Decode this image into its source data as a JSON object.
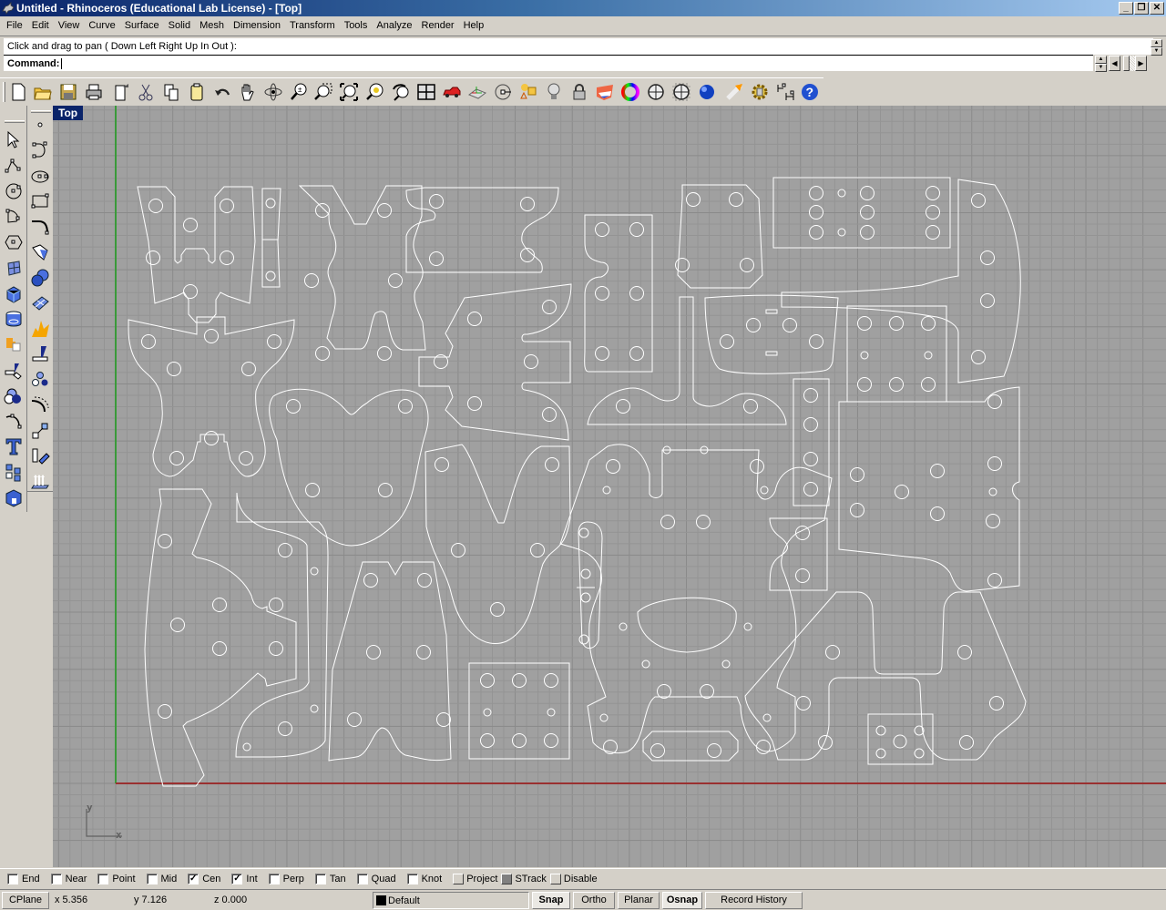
{
  "window": {
    "title": "Untitled - Rhinoceros (Educational Lab License) - [Top]",
    "controls": [
      "minimize",
      "restore",
      "close"
    ]
  },
  "menu": [
    "File",
    "Edit",
    "View",
    "Curve",
    "Surface",
    "Solid",
    "Mesh",
    "Dimension",
    "Transform",
    "Tools",
    "Analyze",
    "Render",
    "Help"
  ],
  "command": {
    "history": "Click and drag to pan ( Down  Left  Right  Up  In  Out ):",
    "prompt_label": "Command:",
    "value": ""
  },
  "toolbar": [
    {
      "name": "new-icon",
      "tip": "New"
    },
    {
      "name": "open-icon",
      "tip": "Open"
    },
    {
      "name": "save-icon",
      "tip": "Save"
    },
    {
      "name": "print-icon",
      "tip": "Print"
    },
    {
      "name": "import-icon",
      "tip": "Import"
    },
    {
      "name": "cut-icon",
      "tip": "Cut"
    },
    {
      "name": "copy-icon",
      "tip": "Copy"
    },
    {
      "name": "paste-icon",
      "tip": "Paste"
    },
    {
      "name": "undo-icon",
      "tip": "Undo"
    },
    {
      "name": "pan-icon",
      "tip": "Pan"
    },
    {
      "name": "rotate-view-icon",
      "tip": "Rotate View"
    },
    {
      "name": "zoom-dynamic-icon",
      "tip": "Zoom Dynamic"
    },
    {
      "name": "zoom-window-icon",
      "tip": "Zoom Window"
    },
    {
      "name": "zoom-extents-icon",
      "tip": "Zoom Extents"
    },
    {
      "name": "zoom-selected-icon",
      "tip": "Zoom Selected"
    },
    {
      "name": "undo-view-icon",
      "tip": "Undo View Change"
    },
    {
      "name": "four-viewports-icon",
      "tip": "4 Viewports"
    },
    {
      "name": "car-icon",
      "tip": "Viewport Properties"
    },
    {
      "name": "cplane-icon",
      "tip": "Set CPlane"
    },
    {
      "name": "point-snap-icon",
      "tip": "Object Snap"
    },
    {
      "name": "select-by-type-icon",
      "tip": "Select"
    },
    {
      "name": "lightbulb-icon",
      "tip": "Show/Hide"
    },
    {
      "name": "lock-icon",
      "tip": "Lock"
    },
    {
      "name": "layer-icon",
      "tip": "Edit Layers"
    },
    {
      "name": "color-wheel-icon",
      "tip": "Object Properties"
    },
    {
      "name": "shaded-sphere-icon",
      "tip": "Wireframe/Shaded"
    },
    {
      "name": "grid-sphere-icon",
      "tip": "Ghosted"
    },
    {
      "name": "render-sphere-icon",
      "tip": "Rendered"
    },
    {
      "name": "render-light-icon",
      "tip": "Render"
    },
    {
      "name": "options-gear-icon",
      "tip": "Options"
    },
    {
      "name": "dimension-icon",
      "tip": "Dimension"
    },
    {
      "name": "help-icon",
      "tip": "Help"
    }
  ],
  "left_toolbar_a": [
    {
      "name": "select-arrow-icon"
    },
    {
      "name": "polyline-icon"
    },
    {
      "name": "circle-icon"
    },
    {
      "name": "arc-icon"
    },
    {
      "name": "polygon-icon"
    },
    {
      "name": "surface-from-points-icon"
    },
    {
      "name": "box-solid-icon"
    },
    {
      "name": "cylinder-icon"
    },
    {
      "name": "boolean-puzzle-icon"
    },
    {
      "name": "split-icon"
    },
    {
      "name": "boolean-spheres-icon"
    },
    {
      "name": "curve-edit-icon"
    },
    {
      "name": "text-icon"
    },
    {
      "name": "array-icon"
    },
    {
      "name": "blue-block-icon"
    }
  ],
  "left_toolbar_b": [
    {
      "name": "point-icon"
    },
    {
      "name": "curve-icon"
    },
    {
      "name": "ellipse-icon"
    },
    {
      "name": "rectangle-icon"
    },
    {
      "name": "fillet-icon"
    },
    {
      "name": "surface-icon"
    },
    {
      "name": "spheres-icon"
    },
    {
      "name": "mesh-surface-icon"
    },
    {
      "name": "explode-icon"
    },
    {
      "name": "trim-icon"
    },
    {
      "name": "group-icon"
    },
    {
      "name": "offset-curve-icon"
    },
    {
      "name": "move-icon"
    },
    {
      "name": "rotate-icon"
    },
    {
      "name": "extrude-icon"
    }
  ],
  "viewport": {
    "label": "Top",
    "axis_labels": {
      "x": "x",
      "y": "y"
    },
    "colors": {
      "background": "#a0a0a0",
      "grid_minor": "#949494",
      "grid_major": "#8a8a8a",
      "x_axis": "#9a3030",
      "y_axis": "#3a9a3a",
      "curves": "#ffffff"
    }
  },
  "osnaps": [
    {
      "label": "End",
      "checked": false
    },
    {
      "label": "Near",
      "checked": false
    },
    {
      "label": "Point",
      "checked": false
    },
    {
      "label": "Mid",
      "checked": false
    },
    {
      "label": "Cen",
      "checked": true
    },
    {
      "label": "Int",
      "checked": true
    },
    {
      "label": "Perp",
      "checked": false
    },
    {
      "label": "Tan",
      "checked": false
    },
    {
      "label": "Quad",
      "checked": false
    },
    {
      "label": "Knot",
      "checked": false
    },
    {
      "label": "Project",
      "checked": false,
      "style": "button"
    },
    {
      "label": "STrack",
      "checked": true,
      "style": "button"
    },
    {
      "label": "Disable",
      "checked": false,
      "style": "button"
    }
  ],
  "status": {
    "cplane": "CPlane",
    "x": "x 5.356",
    "y": "y 7.126",
    "z": "z 0.000",
    "layer": "Default",
    "layer_color": "#000000",
    "toggles": [
      {
        "label": "Snap",
        "on": true
      },
      {
        "label": "Ortho",
        "on": false
      },
      {
        "label": "Planar",
        "on": false
      },
      {
        "label": "Osnap",
        "on": true
      },
      {
        "label": "Record History",
        "on": false
      }
    ]
  }
}
